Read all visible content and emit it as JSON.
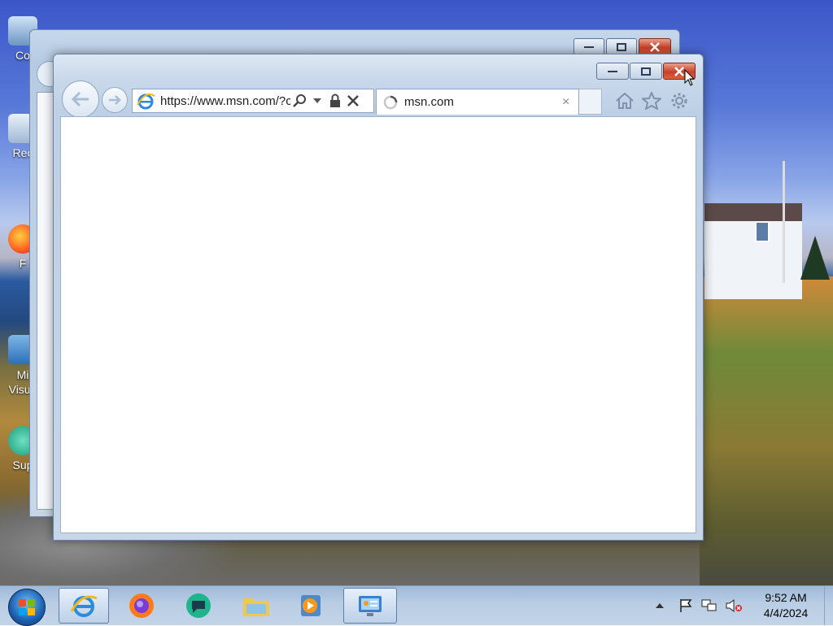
{
  "desktop": {
    "icons": [
      {
        "label": "Co",
        "icon": "computer-icon"
      },
      {
        "label": "Rec",
        "icon": "recycle-bin-icon"
      },
      {
        "label": "F",
        "icon": "firefox-shortcut-icon"
      },
      {
        "label": "Mi",
        "label2": "Visua",
        "icon": "visual-studio-shortcut-icon"
      },
      {
        "label": "Sup",
        "icon": "support-shortcut-icon"
      }
    ]
  },
  "browser": {
    "address": {
      "url": "https://www.msn.com/?c"
    },
    "tab": {
      "title": "msn.com",
      "close_label": "×"
    },
    "icons": [
      "back-icon",
      "forward-icon",
      "ie-logo-icon",
      "search-icon",
      "dropdown-arrow-icon",
      "lock-icon",
      "stop-icon",
      "loading-spinner-icon",
      "home-icon",
      "favorites-star-icon",
      "settings-gear-icon"
    ]
  },
  "taskbar": {
    "items": [
      "internet-explorer",
      "firefox",
      "chat-app",
      "file-explorer",
      "media-player",
      "control-panel"
    ],
    "clock": {
      "time": "9:52 AM",
      "date": "4/4/2024"
    }
  },
  "colors": {
    "close_button": "#c9402a",
    "window_frame": "#c9d9eb",
    "taskbar": "#b9cde4"
  }
}
